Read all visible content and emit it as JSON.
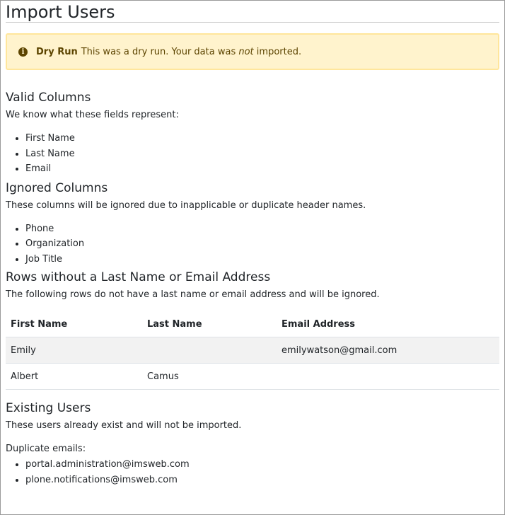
{
  "page": {
    "title": "Import Users"
  },
  "alert": {
    "icon": "info-icon",
    "icon_glyph": "i",
    "title": "Dry Run",
    "text_before": "This was a dry run. Your data was ",
    "text_emphasis": "not",
    "text_after": " imported."
  },
  "valid_columns": {
    "heading": "Valid Columns",
    "description": "We know what these fields represent:",
    "items": [
      "First Name",
      "Last Name",
      "Email"
    ]
  },
  "ignored_columns": {
    "heading": "Ignored Columns",
    "description": "These columns will be ignored due to inapplicable or duplicate header names.",
    "items": [
      "Phone",
      "Organization",
      "Job Title"
    ]
  },
  "rows_without": {
    "heading": "Rows without a Last Name or Email Address",
    "description": "The following rows do not have a last name or email address and will be ignored.",
    "headers": [
      "First Name",
      "Last Name",
      "Email Address"
    ],
    "rows": [
      [
        "Emily",
        "",
        "emilywatson@gmail.com"
      ],
      [
        "Albert",
        "Camus",
        ""
      ]
    ]
  },
  "existing_users": {
    "heading": "Existing Users",
    "description": "These users already exist and will not be imported.",
    "duplicate_label": "Duplicate emails:",
    "emails": [
      "portal.administration@imsweb.com",
      "plone.notifications@imsweb.com"
    ]
  }
}
